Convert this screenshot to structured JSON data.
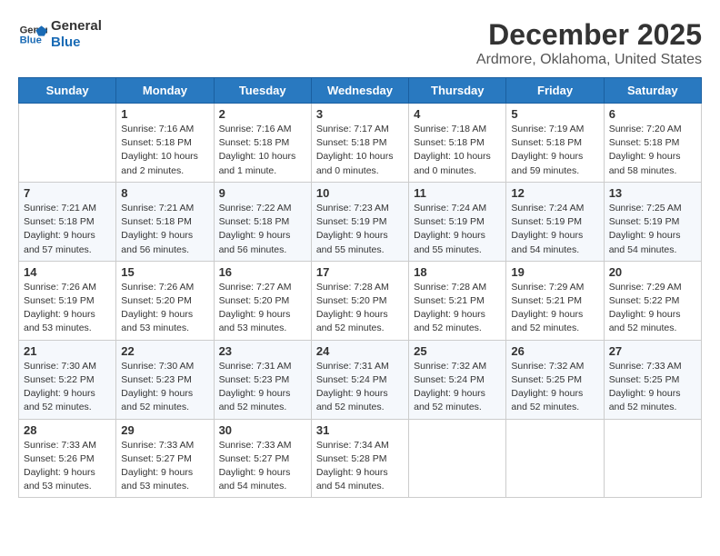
{
  "logo": {
    "line1": "General",
    "line2": "Blue"
  },
  "title": "December 2025",
  "subtitle": "Ardmore, Oklahoma, United States",
  "weekdays": [
    "Sunday",
    "Monday",
    "Tuesday",
    "Wednesday",
    "Thursday",
    "Friday",
    "Saturday"
  ],
  "weeks": [
    [
      {
        "day": "",
        "info": ""
      },
      {
        "day": "1",
        "info": "Sunrise: 7:16 AM\nSunset: 5:18 PM\nDaylight: 10 hours\nand 2 minutes."
      },
      {
        "day": "2",
        "info": "Sunrise: 7:16 AM\nSunset: 5:18 PM\nDaylight: 10 hours\nand 1 minute."
      },
      {
        "day": "3",
        "info": "Sunrise: 7:17 AM\nSunset: 5:18 PM\nDaylight: 10 hours\nand 0 minutes."
      },
      {
        "day": "4",
        "info": "Sunrise: 7:18 AM\nSunset: 5:18 PM\nDaylight: 10 hours\nand 0 minutes."
      },
      {
        "day": "5",
        "info": "Sunrise: 7:19 AM\nSunset: 5:18 PM\nDaylight: 9 hours\nand 59 minutes."
      },
      {
        "day": "6",
        "info": "Sunrise: 7:20 AM\nSunset: 5:18 PM\nDaylight: 9 hours\nand 58 minutes."
      }
    ],
    [
      {
        "day": "7",
        "info": "Sunrise: 7:21 AM\nSunset: 5:18 PM\nDaylight: 9 hours\nand 57 minutes."
      },
      {
        "day": "8",
        "info": "Sunrise: 7:21 AM\nSunset: 5:18 PM\nDaylight: 9 hours\nand 56 minutes."
      },
      {
        "day": "9",
        "info": "Sunrise: 7:22 AM\nSunset: 5:18 PM\nDaylight: 9 hours\nand 56 minutes."
      },
      {
        "day": "10",
        "info": "Sunrise: 7:23 AM\nSunset: 5:19 PM\nDaylight: 9 hours\nand 55 minutes."
      },
      {
        "day": "11",
        "info": "Sunrise: 7:24 AM\nSunset: 5:19 PM\nDaylight: 9 hours\nand 55 minutes."
      },
      {
        "day": "12",
        "info": "Sunrise: 7:24 AM\nSunset: 5:19 PM\nDaylight: 9 hours\nand 54 minutes."
      },
      {
        "day": "13",
        "info": "Sunrise: 7:25 AM\nSunset: 5:19 PM\nDaylight: 9 hours\nand 54 minutes."
      }
    ],
    [
      {
        "day": "14",
        "info": "Sunrise: 7:26 AM\nSunset: 5:19 PM\nDaylight: 9 hours\nand 53 minutes."
      },
      {
        "day": "15",
        "info": "Sunrise: 7:26 AM\nSunset: 5:20 PM\nDaylight: 9 hours\nand 53 minutes."
      },
      {
        "day": "16",
        "info": "Sunrise: 7:27 AM\nSunset: 5:20 PM\nDaylight: 9 hours\nand 53 minutes."
      },
      {
        "day": "17",
        "info": "Sunrise: 7:28 AM\nSunset: 5:20 PM\nDaylight: 9 hours\nand 52 minutes."
      },
      {
        "day": "18",
        "info": "Sunrise: 7:28 AM\nSunset: 5:21 PM\nDaylight: 9 hours\nand 52 minutes."
      },
      {
        "day": "19",
        "info": "Sunrise: 7:29 AM\nSunset: 5:21 PM\nDaylight: 9 hours\nand 52 minutes."
      },
      {
        "day": "20",
        "info": "Sunrise: 7:29 AM\nSunset: 5:22 PM\nDaylight: 9 hours\nand 52 minutes."
      }
    ],
    [
      {
        "day": "21",
        "info": "Sunrise: 7:30 AM\nSunset: 5:22 PM\nDaylight: 9 hours\nand 52 minutes."
      },
      {
        "day": "22",
        "info": "Sunrise: 7:30 AM\nSunset: 5:23 PM\nDaylight: 9 hours\nand 52 minutes."
      },
      {
        "day": "23",
        "info": "Sunrise: 7:31 AM\nSunset: 5:23 PM\nDaylight: 9 hours\nand 52 minutes."
      },
      {
        "day": "24",
        "info": "Sunrise: 7:31 AM\nSunset: 5:24 PM\nDaylight: 9 hours\nand 52 minutes."
      },
      {
        "day": "25",
        "info": "Sunrise: 7:32 AM\nSunset: 5:24 PM\nDaylight: 9 hours\nand 52 minutes."
      },
      {
        "day": "26",
        "info": "Sunrise: 7:32 AM\nSunset: 5:25 PM\nDaylight: 9 hours\nand 52 minutes."
      },
      {
        "day": "27",
        "info": "Sunrise: 7:33 AM\nSunset: 5:25 PM\nDaylight: 9 hours\nand 52 minutes."
      }
    ],
    [
      {
        "day": "28",
        "info": "Sunrise: 7:33 AM\nSunset: 5:26 PM\nDaylight: 9 hours\nand 53 minutes."
      },
      {
        "day": "29",
        "info": "Sunrise: 7:33 AM\nSunset: 5:27 PM\nDaylight: 9 hours\nand 53 minutes."
      },
      {
        "day": "30",
        "info": "Sunrise: 7:33 AM\nSunset: 5:27 PM\nDaylight: 9 hours\nand 54 minutes."
      },
      {
        "day": "31",
        "info": "Sunrise: 7:34 AM\nSunset: 5:28 PM\nDaylight: 9 hours\nand 54 minutes."
      },
      {
        "day": "",
        "info": ""
      },
      {
        "day": "",
        "info": ""
      },
      {
        "day": "",
        "info": ""
      }
    ]
  ]
}
